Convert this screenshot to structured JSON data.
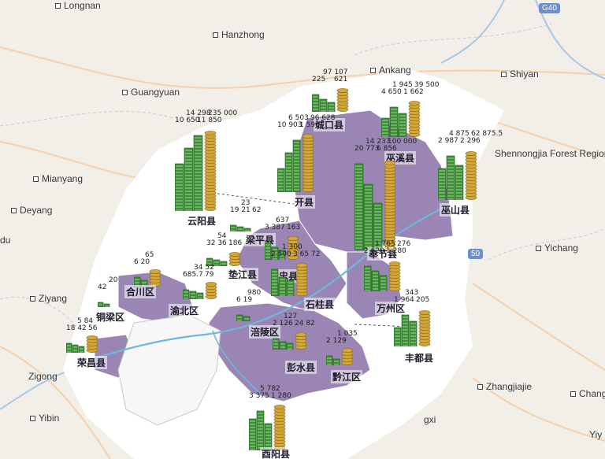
{
  "base_cities": [
    {
      "id": "longnan",
      "name": "Longnan"
    },
    {
      "id": "hanzhong",
      "name": "Hanzhong"
    },
    {
      "id": "ankang",
      "name": "Ankang"
    },
    {
      "id": "shiyan",
      "name": "Shiyan"
    },
    {
      "id": "guangyuan",
      "name": "Guangyuan"
    },
    {
      "id": "mianyang",
      "name": "Mianyang"
    },
    {
      "id": "deyang",
      "name": "Deyang"
    },
    {
      "id": "du",
      "name": "du"
    },
    {
      "id": "ziyang",
      "name": "Ziyang"
    },
    {
      "id": "zigong",
      "name": "Zigong"
    },
    {
      "id": "yibin",
      "name": "Yibin"
    },
    {
      "id": "yichang",
      "name": "Yichang"
    },
    {
      "id": "shennongjia",
      "name": "Shennongjia Forest Region"
    },
    {
      "id": "zhangjiajie",
      "name": "Zhangjiajie"
    },
    {
      "id": "changde",
      "name": "Changde"
    },
    {
      "id": "yiy",
      "name": "Yiy"
    },
    {
      "id": "gxi",
      "name": "gxi"
    }
  ],
  "shields": [
    {
      "id": "g40",
      "label": "G40"
    },
    {
      "id": "g50",
      "label": "50"
    }
  ],
  "counties": [
    {
      "id": "chengkou",
      "name": "城口县",
      "values": [
        "225",
        "97 107",
        "621"
      ]
    },
    {
      "id": "wuxi",
      "name": "巫溪县",
      "values": [
        "4 650",
        "1 945",
        "1 662",
        "39 500"
      ]
    },
    {
      "id": "yunyang",
      "name": "云阳县",
      "values": [
        "10 650",
        "14 298",
        "11 850",
        "235 000"
      ]
    },
    {
      "id": "kaixian",
      "name": "开县",
      "values": [
        "10 903",
        "6 503",
        "1 596",
        "96 628"
      ]
    },
    {
      "id": "fengjie",
      "name": "奉节县",
      "values": [
        "20 773",
        "14 237",
        "6 856",
        "100 000"
      ]
    },
    {
      "id": "wushan",
      "name": "巫山县",
      "values": [
        "2 987",
        "4 875",
        "2 296",
        "62 875.5"
      ]
    },
    {
      "id": "liangping",
      "name": "梁平县",
      "values": [
        "19 21",
        "23",
        "62"
      ]
    },
    {
      "id": "dianjiang",
      "name": "垫江县",
      "values": [
        "32 36",
        "54",
        "186"
      ]
    },
    {
      "id": "zhongxian",
      "name": "忠县",
      "values": [
        "3 387",
        "637",
        "163"
      ]
    },
    {
      "id": "hechuan",
      "name": "合川区",
      "values": [
        "6 20",
        "65"
      ]
    },
    {
      "id": "tongnan",
      "name": "铜梁区",
      "values": [
        "42",
        "20"
      ]
    },
    {
      "id": "changshou",
      "name": "渝北区",
      "values": [
        "685.7",
        "34 52",
        "79"
      ]
    },
    {
      "id": "shizhu",
      "name": "石柱县",
      "values": [
        "2 500",
        "1 300",
        "3 65 72"
      ]
    },
    {
      "id": "fuling",
      "name": "涪陵区",
      "values": [
        "6 19",
        "980"
      ]
    },
    {
      "id": "wanzhou",
      "name": "万州区",
      "values": [
        "2 620",
        "1 765",
        "1 280",
        "276"
      ]
    },
    {
      "id": "fengdu",
      "name": "丰都县",
      "values": [
        "1 964",
        "343",
        "205"
      ]
    },
    {
      "id": "pengshui",
      "name": "彭水县",
      "values": [
        "2 126",
        "127",
        "24 82"
      ]
    },
    {
      "id": "qianjiang",
      "name": "黔江区",
      "values": [
        "2 129",
        "1 035"
      ]
    },
    {
      "id": "rongchang",
      "name": "荣昌县",
      "values": [
        "18 42",
        "5 84",
        "56"
      ]
    },
    {
      "id": "youyang",
      "name": "酉阳县",
      "values": [
        "3 375",
        "5 782",
        "1 280"
      ]
    }
  ],
  "colors": {
    "land": "#f2efe9",
    "mask": "#ffffff",
    "region": "#9a85b4",
    "bar_green": "#3f8f3a",
    "coin": "#d2a73b"
  }
}
